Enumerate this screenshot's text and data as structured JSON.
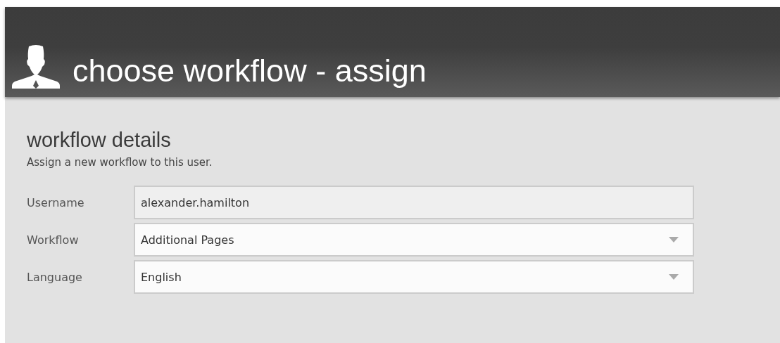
{
  "header": {
    "title": "choose workflow - assign"
  },
  "section": {
    "heading": "workflow details",
    "description": "Assign a new workflow to this user."
  },
  "fields": [
    {
      "label": "Username",
      "kind": "text",
      "value": "alexander.hamilton"
    },
    {
      "label": "Workflow",
      "kind": "select",
      "value": "Additional Pages"
    },
    {
      "label": "Language",
      "kind": "select",
      "value": "English"
    }
  ]
}
